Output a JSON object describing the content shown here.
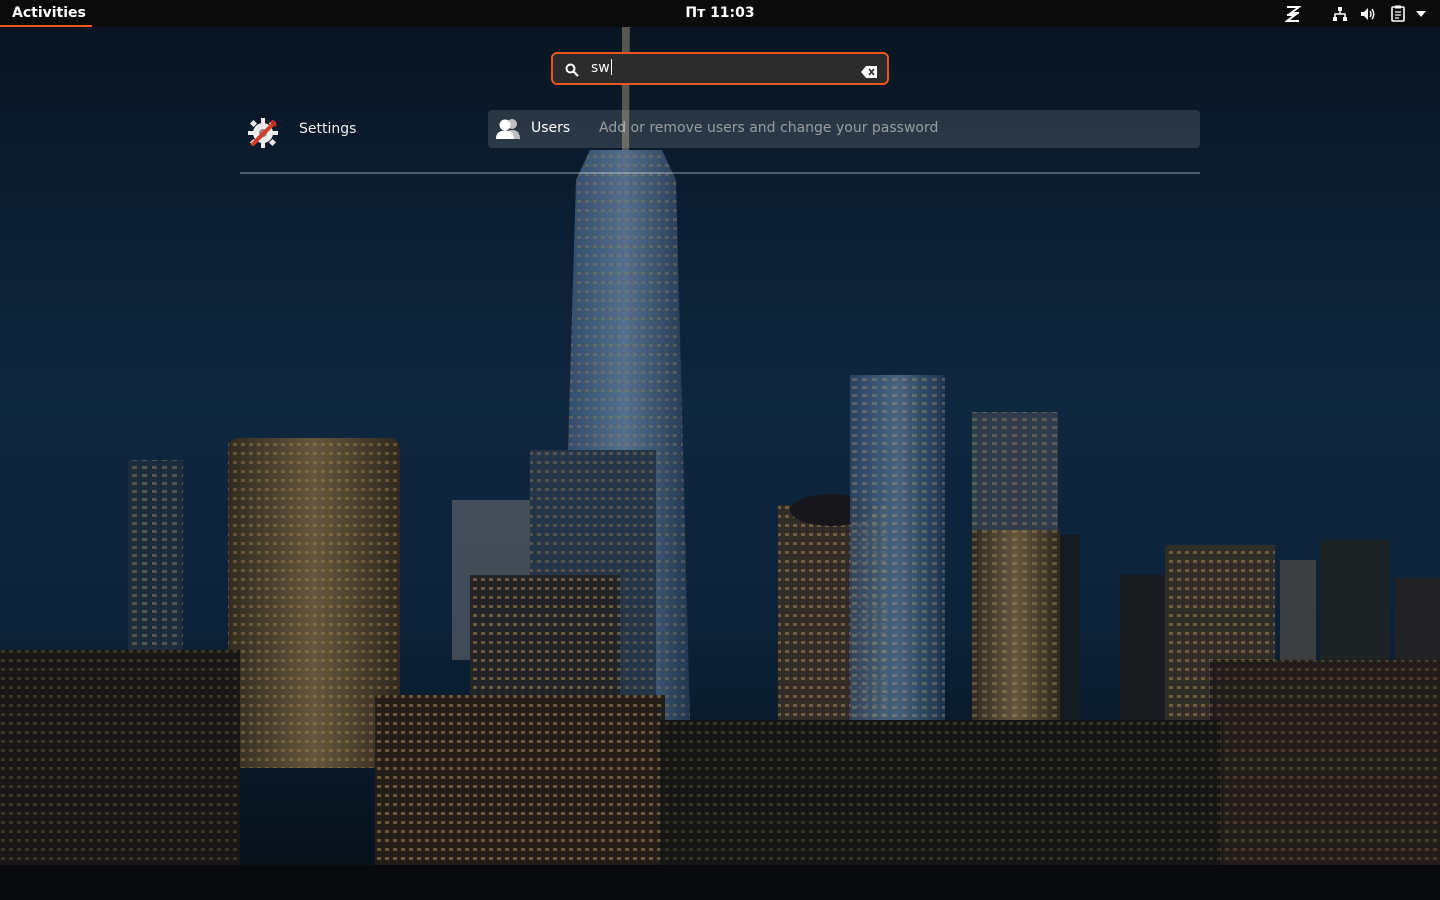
{
  "topbar": {
    "activities_label": "Activities",
    "clock": "Пт 11:03",
    "indicators": [
      "zorin-icon",
      "network-icon",
      "volume-icon",
      "clipboard-icon",
      "system-menu-arrow-icon"
    ]
  },
  "search": {
    "value": "sw",
    "icon": "search-icon",
    "clear_icon": "clear-icon"
  },
  "results": {
    "provider": {
      "label": "Settings",
      "icon": "settings-app-icon"
    },
    "items": [
      {
        "title": "Users",
        "description": "Add or remove users and change your password",
        "icon": "users-icon"
      }
    ]
  },
  "colors": {
    "accent": "#e95420",
    "topbar": "#0b0b0b",
    "result_highlight": "rgba(255,255,255,0.13)"
  }
}
